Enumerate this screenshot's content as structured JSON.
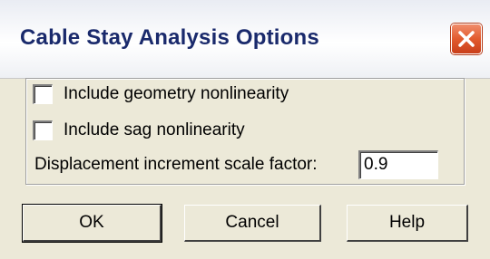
{
  "window": {
    "title": "Cable Stay Analysis Options"
  },
  "options": {
    "geometry_nonlinearity": {
      "label": "Include geometry nonlinearity",
      "checked": false
    },
    "sag_nonlinearity": {
      "label": "Include sag nonlinearity",
      "checked": false
    },
    "displacement_scale": {
      "label": "Displacement increment scale factor:",
      "value": "0.9"
    }
  },
  "buttons": {
    "ok": "OK",
    "cancel": "Cancel",
    "help": "Help"
  },
  "icons": {
    "close": "close-icon"
  },
  "colors": {
    "title_text": "#1a2a6c",
    "close_button": "#e25a2e",
    "dialog_background": "#ece9d8"
  }
}
